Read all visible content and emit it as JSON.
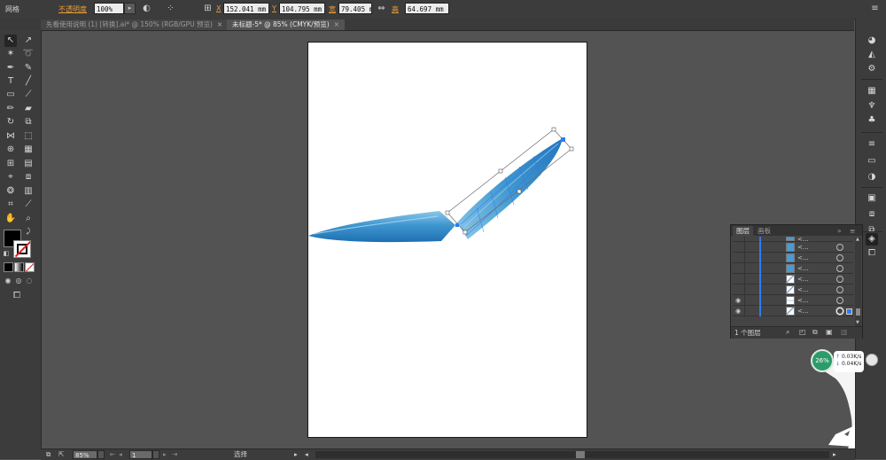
{
  "control_bar": {
    "mode_label": "网格",
    "opacity_label": "不透明度",
    "opacity_value": "100%",
    "x_label": "X",
    "x_value": "152.041",
    "y_label": "Y",
    "y_value": "104.795",
    "width_label": "宽",
    "width_value": "79.405",
    "width_unit": "mm",
    "height_label": "高",
    "height_value": "64.697",
    "height_unit": "mm",
    "mm": "mm"
  },
  "tabs": [
    {
      "label": "先看使用说明 (1) [转换].ai* @ 150% (RGB/GPU 预览)",
      "close": "×",
      "active": false
    },
    {
      "label": "未标题-5* @ 85% (CMYK/预览)",
      "close": "×",
      "active": true
    }
  ],
  "layers_panel": {
    "tabs": [
      "图层",
      "画板"
    ],
    "row_names": [
      "<...",
      "<...",
      "<...",
      "<...",
      "<...",
      "<...",
      "<...",
      "<..."
    ],
    "footer_text": "1 个图层",
    "menu_glyph": "≡",
    "expand_glyph": "»"
  },
  "status_bar": {
    "zoom": "85%",
    "artboard": "1",
    "tool_label": "选择"
  },
  "net_widget": {
    "percent": "26%",
    "up": "0.03K/s",
    "down": "0.04K/s"
  },
  "colors": {
    "blade_light": "#8cc8ea",
    "blade_mid": "#3f97d0",
    "blade_dark": "#1f6fb0",
    "selection": "#2d7cf0",
    "opacity_label": "#e89b3a"
  }
}
